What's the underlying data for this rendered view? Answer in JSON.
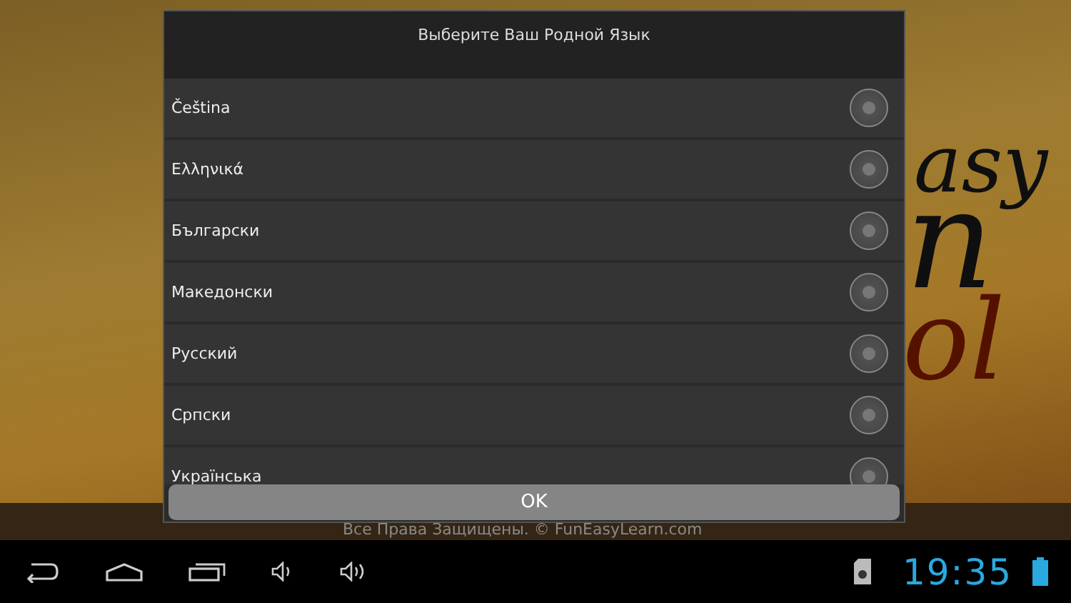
{
  "background": {
    "logo_fragments": [
      "asy",
      "n",
      "ol"
    ],
    "footer": "Все Права Защищены. © FunEasyLearn.com"
  },
  "dialog": {
    "title": "Выберите Ваш Родной Язык",
    "options": [
      {
        "label": "Čeština",
        "selected": false
      },
      {
        "label": "Ελληνικά",
        "selected": false
      },
      {
        "label": "Български",
        "selected": false
      },
      {
        "label": "Македонски",
        "selected": false
      },
      {
        "label": "Русский",
        "selected": false
      },
      {
        "label": "Српски",
        "selected": false
      },
      {
        "label": "Українська",
        "selected": false
      }
    ],
    "button": "OK"
  },
  "status_bar": {
    "time": "19:35"
  }
}
